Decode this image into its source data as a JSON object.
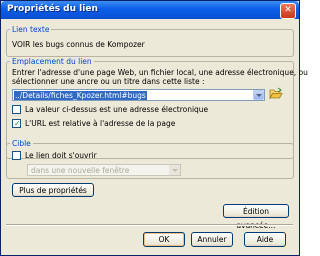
{
  "window": {
    "title": "Propriétés du lien"
  },
  "link_text": {
    "legend": "Lien texte",
    "value": "VOIR les bugs connus de Kompozer"
  },
  "link_location": {
    "legend": "Emplacement du lien",
    "instructions_line1": "Entrer l'adresse d'une page Web, un fichier local, une adresse électronique, ou",
    "instructions_line2": "sélectionner une ancre ou un titre dans cette liste :",
    "url_value": "../Details/fiches_Kpozer.html#bugs",
    "email_checkbox_label": "La valeur ci-dessus est une adresse électronique",
    "email_checked": false,
    "relative_checkbox_label": "L'URL est relative à l'adresse de la page",
    "relative_checked": true
  },
  "target": {
    "legend": "Cible",
    "open_checkbox_label": "Le lien doit s'ouvrir",
    "open_checked": false,
    "dropdown_value": "dans une nouvelle fenêtre"
  },
  "buttons": {
    "more_properties": "Plus de propriétés",
    "advanced_edit": "Édition avancée...",
    "ok": "OK",
    "cancel": "Annuler",
    "help": "Aide"
  }
}
